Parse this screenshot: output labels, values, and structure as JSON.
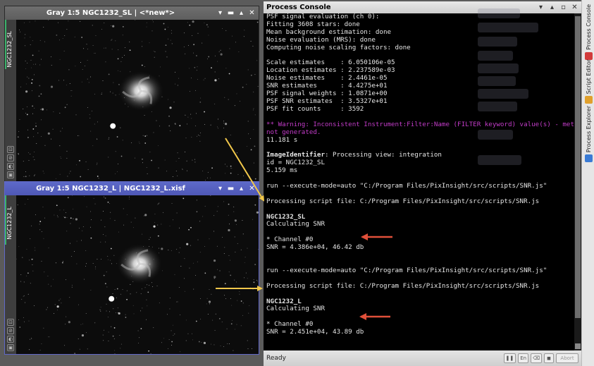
{
  "windows": {
    "top": {
      "title": "Gray 1:5 NGC1232_SL | <*new*>",
      "side_label": "NGC1232_SL"
    },
    "bottom": {
      "title": "Gray 1:5 NGC1232_L | NGC1232_L.xisf",
      "side_label": "NGC1232_L"
    }
  },
  "console": {
    "title": "Process Console",
    "lines": [
      "PSF signal evaluation (ch 0):",
      "Fitting 3608 stars: done",
      "Mean background estimation: done",
      "Noise evaluation (MRS): done",
      "Computing noise scaling factors: done",
      "",
      "Scale estimates    : 6.050106e-05",
      "Location estimates : 2.237589e-03",
      "Noise estimates    : 2.4461e-05",
      "SNR estimates      : 4.4275e+01",
      "PSF signal weights : 1.0871e+00",
      "PSF SNR estimates  : 3.5327e+01",
      "PSF fit counts     : 3592",
      "",
      "** Warning: Inconsistent Instrument:Filter:Name (FILTER keyword) value(s) - metadata",
      "not generated.",
      "11.181 s",
      "",
      "ImageIdentifier: Processing view: integration",
      "id = NGC1232_SL",
      "5.159 ms",
      "",
      "run --execute-mode=auto \"C:/Program Files/PixInsight/src/scripts/SNR.js\"",
      "",
      "Processing script file: C:/Program Files/PixInsight/src/scripts/SNR.js",
      "",
      "NGC1232_SL",
      "Calculating SNR",
      "",
      "* Channel #0",
      "SNR = 4.386e+04, 46.42 db",
      "",
      "",
      "run --execute-mode=auto \"C:/Program Files/PixInsight/src/scripts/SNR.js\"",
      "",
      "Processing script file: C:/Program Files/PixInsight/src/scripts/SNR.js",
      "",
      "NGC1232_L",
      "Calculating SNR",
      "",
      "* Channel #0",
      "SNR = 2.451e+04, 43.89 db"
    ],
    "status": "Ready",
    "status_chips": [
      "En",
      "Abort"
    ]
  },
  "dock": {
    "tabs": [
      "Process Console",
      "Script Editor",
      "Process Explorer"
    ]
  },
  "colors": {
    "warning": "#c23cc8",
    "arrow_yellow": "#f2c84b",
    "arrow_red": "#e0503a",
    "active_title": "#5561c2"
  }
}
